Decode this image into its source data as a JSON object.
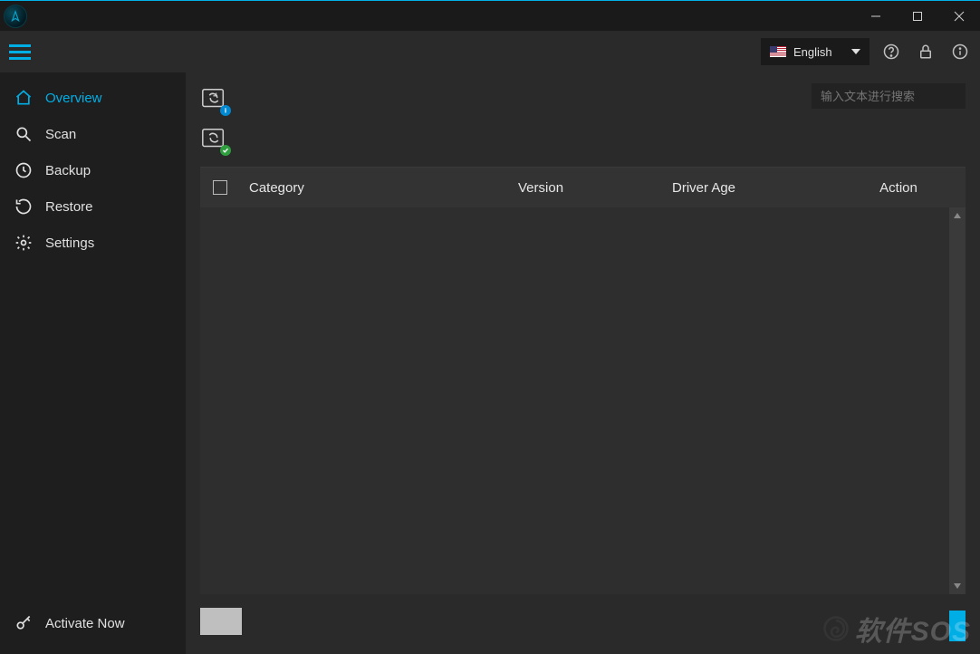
{
  "language": {
    "label": "English"
  },
  "search": {
    "placeholder": "输入文本进行搜索"
  },
  "sidebar": {
    "items": [
      {
        "label": "Overview"
      },
      {
        "label": "Scan"
      },
      {
        "label": "Backup"
      },
      {
        "label": "Restore"
      },
      {
        "label": "Settings"
      }
    ],
    "activate": "Activate Now"
  },
  "table": {
    "headers": {
      "category": "Category",
      "version": "Version",
      "driver_age": "Driver Age",
      "action": "Action"
    }
  },
  "watermark": "软件SOS"
}
